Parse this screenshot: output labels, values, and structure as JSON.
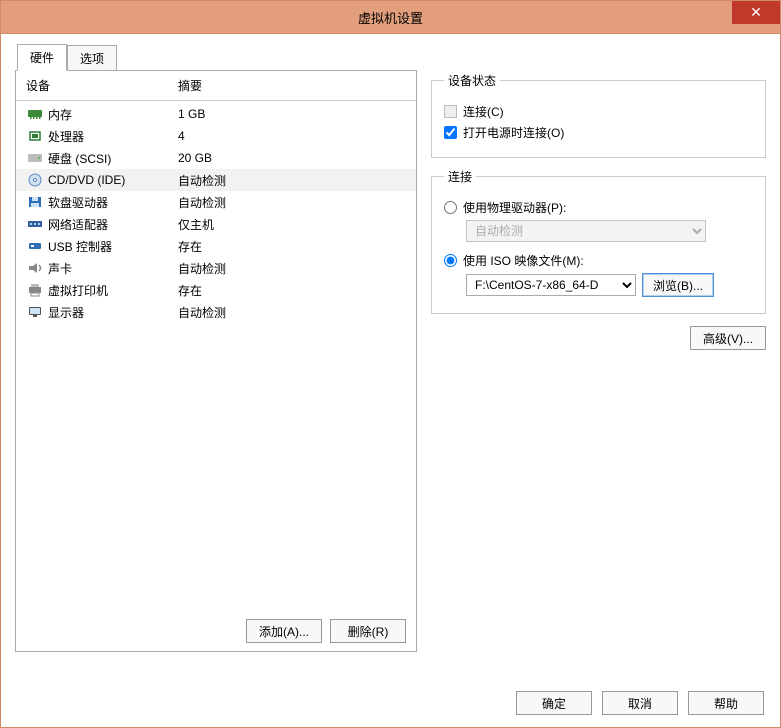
{
  "window": {
    "title": "虚拟机设置",
    "close_icon": "✕"
  },
  "tabs": {
    "hardware": "硬件",
    "options": "选项"
  },
  "device_table": {
    "col_device": "设备",
    "col_summary": "摘要",
    "rows": [
      {
        "icon": "memory",
        "name": "内存",
        "summary": "1 GB"
      },
      {
        "icon": "cpu",
        "name": "处理器",
        "summary": "4"
      },
      {
        "icon": "hdd",
        "name": "硬盘 (SCSI)",
        "summary": "20 GB"
      },
      {
        "icon": "cd",
        "name": "CD/DVD (IDE)",
        "summary": "自动检测"
      },
      {
        "icon": "floppy",
        "name": "软盘驱动器",
        "summary": "自动检测"
      },
      {
        "icon": "net",
        "name": "网络适配器",
        "summary": "仅主机"
      },
      {
        "icon": "usb",
        "name": "USB 控制器",
        "summary": "存在"
      },
      {
        "icon": "sound",
        "name": "声卡",
        "summary": "自动检测"
      },
      {
        "icon": "printer",
        "name": "虚拟打印机",
        "summary": "存在"
      },
      {
        "icon": "display",
        "name": "显示器",
        "summary": "自动检测"
      }
    ],
    "selected_index": 3
  },
  "left_buttons": {
    "add": "添加(A)...",
    "remove": "删除(R)"
  },
  "device_status": {
    "legend": "设备状态",
    "connected_label": "连接(C)",
    "connect_power_on_label": "打开电源时连接(O)"
  },
  "connection": {
    "legend": "连接",
    "physical_label": "使用物理驱动器(P):",
    "physical_select_value": "自动检测",
    "iso_label": "使用 ISO 映像文件(M):",
    "iso_path_value": "F:\\CentOS-7-x86_64-D",
    "browse_label": "浏览(B)..."
  },
  "advanced_label": "高级(V)...",
  "bottom": {
    "ok": "确定",
    "cancel": "取消",
    "help": "帮助"
  }
}
